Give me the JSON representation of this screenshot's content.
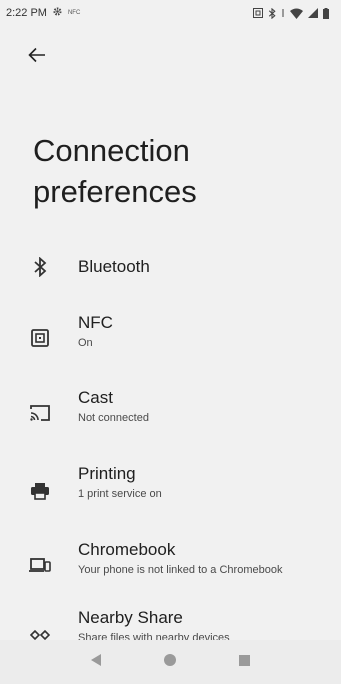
{
  "status_bar": {
    "time": "2:22 PM",
    "icons": [
      "gear-icon",
      "nfc-small-icon",
      "screenshot-icon",
      "bluetooth-icon",
      "data-icon",
      "wifi-icon",
      "signal-icon",
      "battery-icon"
    ]
  },
  "header": {
    "back_icon": "arrow-left-icon",
    "title": "Connection preferences"
  },
  "items": [
    {
      "label": "Bluetooth",
      "summary": "",
      "icon": "bluetooth-icon"
    },
    {
      "label": "NFC",
      "summary": "On",
      "icon": "nfc-icon"
    },
    {
      "label": "Cast",
      "summary": "Not connected",
      "icon": "cast-icon"
    },
    {
      "label": "Printing",
      "summary": "1 print service on",
      "icon": "printer-icon"
    },
    {
      "label": "Chromebook",
      "summary": "Your phone is not linked to a Chromebook",
      "icon": "chromebook-icon"
    },
    {
      "label": "Nearby Share",
      "summary": "Share files with nearby devices",
      "icon": "nearby-share-icon"
    }
  ],
  "nav_bar": {
    "buttons": [
      "back-triangle-icon",
      "home-circle-icon",
      "recents-square-icon"
    ]
  },
  "colors": {
    "background": "#f1f1f1",
    "text_primary": "#1f1f1f",
    "text_secondary": "#4a4a4a",
    "nav_icons": "#9a9a9a"
  }
}
